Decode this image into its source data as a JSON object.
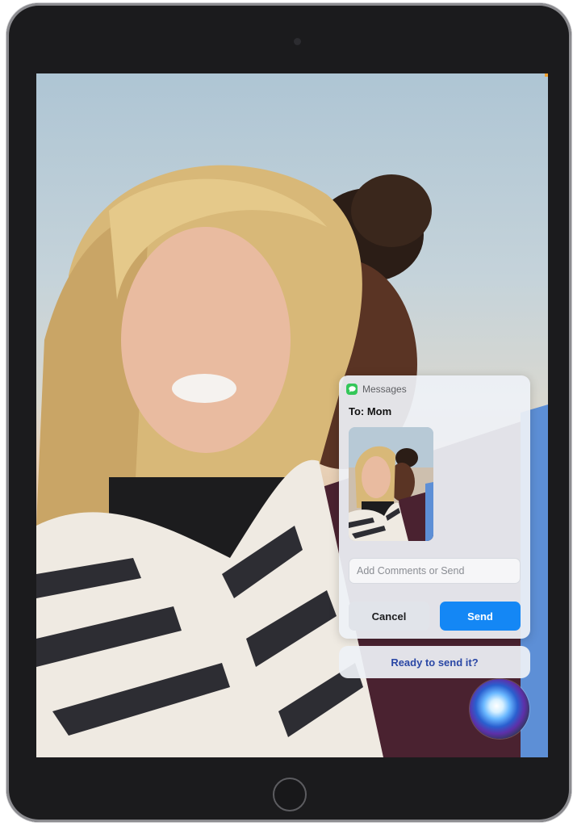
{
  "siri": {
    "app_name": "Messages",
    "recipient": "To: Mom",
    "comment_placeholder": "Add Comments or Send",
    "cancel_label": "Cancel",
    "send_label": "Send",
    "prompt": "Ready to send it?"
  },
  "icons": {
    "messages": "messages-icon",
    "siri": "siri-orb-icon",
    "home": "home-button"
  },
  "colors": {
    "send_button": "#1487f5",
    "messages_icon": "#34c759",
    "prompt_text": "#2a47a5"
  }
}
